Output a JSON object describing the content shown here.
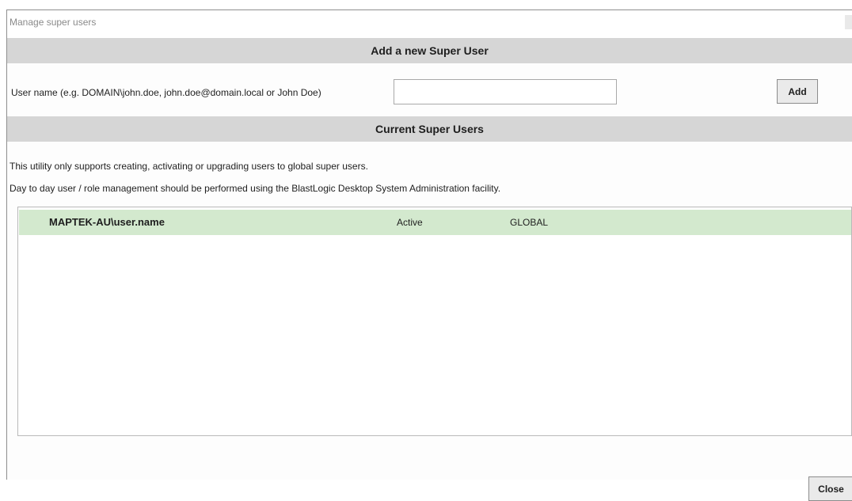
{
  "window": {
    "title": "Manage super users"
  },
  "add_section": {
    "header": "Add a new Super User",
    "username_label": "User name (e.g. DOMAIN\\john.doe, john.doe@domain.local or John Doe)",
    "username_value": "",
    "username_placeholder": "",
    "add_button": "Add"
  },
  "current_section": {
    "header": "Current Super Users",
    "info_line_1": "This utility only supports creating, activating or upgrading users to global super users.",
    "info_line_2": "Day to day user / role management should be performed using the BlastLogic Desktop System Administration facility.",
    "users": [
      {
        "name": "MAPTEK-AU\\user.name",
        "status": "Active",
        "scope": "GLOBAL",
        "selected": true
      }
    ]
  },
  "footer": {
    "close_button": "Close"
  },
  "colors": {
    "section_header_bg": "#d6d6d6",
    "selected_row_bg": "#d3e9ce",
    "button_bg": "#eaeaea"
  }
}
